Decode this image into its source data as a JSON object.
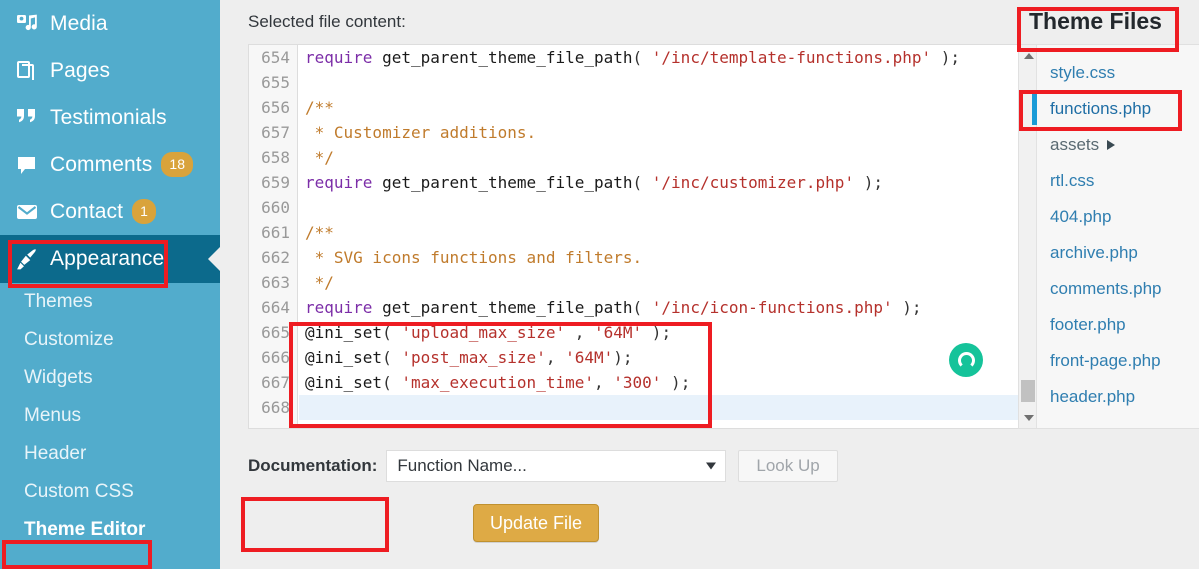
{
  "sidebar": {
    "items": [
      {
        "label": "Media",
        "icon": "media-icon",
        "badge": null
      },
      {
        "label": "Pages",
        "icon": "pages-icon",
        "badge": null
      },
      {
        "label": "Testimonials",
        "icon": "testimonials-icon",
        "badge": null
      },
      {
        "label": "Comments",
        "icon": "comments-icon",
        "badge": "18"
      },
      {
        "label": "Contact",
        "icon": "contact-icon",
        "badge": "1"
      }
    ],
    "current": {
      "label": "Appearance",
      "icon": "appearance-icon"
    },
    "submenu": [
      {
        "label": "Themes",
        "selected": false
      },
      {
        "label": "Customize",
        "selected": false
      },
      {
        "label": "Widgets",
        "selected": false
      },
      {
        "label": "Menus",
        "selected": false
      },
      {
        "label": "Header",
        "selected": false
      },
      {
        "label": "Custom CSS",
        "selected": false
      },
      {
        "label": "Theme Editor",
        "selected": true
      }
    ]
  },
  "main": {
    "selected_file_label": "Selected file content:",
    "documentation_label": "Documentation:",
    "documentation_value": "Function Name...",
    "lookup_label": "Look Up",
    "update_label": "Update File"
  },
  "editor": {
    "first_line_number": 654,
    "lines": [
      {
        "n": "654",
        "active": false,
        "tokens": [
          {
            "t": "require ",
            "c": "kw"
          },
          {
            "t": "get_parent_theme_file_path",
            "c": "fn"
          },
          {
            "t": "( ",
            "c": "pun"
          },
          {
            "t": "'/inc/template-functions.php'",
            "c": "str"
          },
          {
            "t": " );",
            "c": "pun"
          }
        ]
      },
      {
        "n": "655",
        "active": false,
        "tokens": []
      },
      {
        "n": "656",
        "active": false,
        "tokens": [
          {
            "t": "/**",
            "c": "cmt"
          }
        ]
      },
      {
        "n": "657",
        "active": false,
        "tokens": [
          {
            "t": " * Customizer additions.",
            "c": "cmt"
          }
        ]
      },
      {
        "n": "658",
        "active": false,
        "tokens": [
          {
            "t": " */",
            "c": "cmt"
          }
        ]
      },
      {
        "n": "659",
        "active": false,
        "tokens": [
          {
            "t": "require ",
            "c": "kw"
          },
          {
            "t": "get_parent_theme_file_path",
            "c": "fn"
          },
          {
            "t": "( ",
            "c": "pun"
          },
          {
            "t": "'/inc/customizer.php'",
            "c": "str"
          },
          {
            "t": " );",
            "c": "pun"
          }
        ]
      },
      {
        "n": "660",
        "active": false,
        "tokens": []
      },
      {
        "n": "661",
        "active": false,
        "tokens": [
          {
            "t": "/**",
            "c": "cmt"
          }
        ]
      },
      {
        "n": "662",
        "active": false,
        "tokens": [
          {
            "t": " * SVG icons functions and filters.",
            "c": "cmt"
          }
        ]
      },
      {
        "n": "663",
        "active": false,
        "tokens": [
          {
            "t": " */",
            "c": "cmt"
          }
        ]
      },
      {
        "n": "664",
        "active": false,
        "tokens": [
          {
            "t": "require ",
            "c": "kw"
          },
          {
            "t": "get_parent_theme_file_path",
            "c": "fn"
          },
          {
            "t": "( ",
            "c": "pun"
          },
          {
            "t": "'/inc/icon-functions.php'",
            "c": "str"
          },
          {
            "t": " );",
            "c": "pun"
          }
        ]
      },
      {
        "n": "665",
        "active": false,
        "tokens": [
          {
            "t": "@ini_set",
            "c": "fn"
          },
          {
            "t": "( ",
            "c": "pun"
          },
          {
            "t": "'upload_max_size'",
            "c": "str"
          },
          {
            "t": " , ",
            "c": "pun"
          },
          {
            "t": "'64M'",
            "c": "str"
          },
          {
            "t": " );",
            "c": "pun"
          }
        ]
      },
      {
        "n": "666",
        "active": false,
        "tokens": [
          {
            "t": "@ini_set",
            "c": "fn"
          },
          {
            "t": "( ",
            "c": "pun"
          },
          {
            "t": "'post_max_size'",
            "c": "str"
          },
          {
            "t": ", ",
            "c": "pun"
          },
          {
            "t": "'64M'",
            "c": "str"
          },
          {
            "t": ");",
            "c": "pun"
          }
        ]
      },
      {
        "n": "667",
        "active": false,
        "tokens": [
          {
            "t": "@ini_set",
            "c": "fn"
          },
          {
            "t": "( ",
            "c": "pun"
          },
          {
            "t": "'max_execution_time'",
            "c": "str"
          },
          {
            "t": ", ",
            "c": "pun"
          },
          {
            "t": "'300'",
            "c": "str"
          },
          {
            "t": " );",
            "c": "pun"
          }
        ]
      },
      {
        "n": "668",
        "active": true,
        "tokens": []
      }
    ]
  },
  "theme_files": {
    "title": "Theme Files",
    "items": [
      {
        "label": "style.css",
        "type": "file",
        "selected": false
      },
      {
        "label": "functions.php",
        "type": "file",
        "selected": true
      },
      {
        "label": "assets",
        "type": "folder",
        "selected": false
      },
      {
        "label": "rtl.css",
        "type": "file",
        "selected": false
      },
      {
        "label": "404.php",
        "type": "file",
        "selected": false
      },
      {
        "label": "archive.php",
        "type": "file",
        "selected": false
      },
      {
        "label": "comments.php",
        "type": "file",
        "selected": false
      },
      {
        "label": "footer.php",
        "type": "file",
        "selected": false
      },
      {
        "label": "front-page.php",
        "type": "file",
        "selected": false
      },
      {
        "label": "header.php",
        "type": "file",
        "selected": false
      }
    ]
  },
  "colors": {
    "sidebar_bg": "#52accc",
    "sidebar_current_bg": "#0c6a8c",
    "badge_bg": "#d9a33b",
    "annotation_red": "#ee1c22",
    "update_button_bg": "#deaa45",
    "file_link": "#2f7eb0",
    "selected_file_bar": "#1a9bd7"
  }
}
